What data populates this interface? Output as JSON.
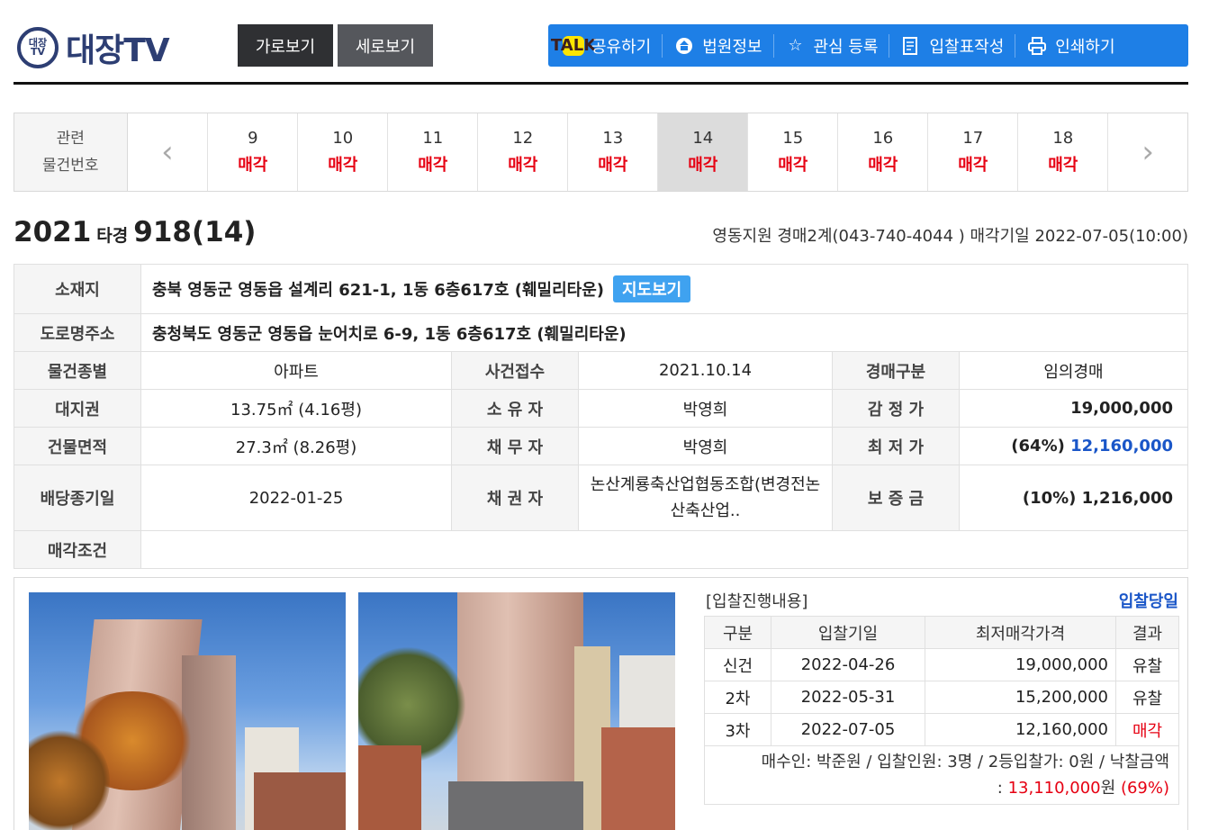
{
  "header": {
    "logo_mark": "대장TV",
    "logo_text": "대장TV",
    "view_horizontal": "가로보기",
    "view_vertical": "세로보기",
    "tools": [
      {
        "icon": "kakao-talk-icon",
        "icon_text": "TALK",
        "label": "공유하기"
      },
      {
        "icon": "court-icon",
        "icon_text": "",
        "label": "법원정보"
      },
      {
        "icon": "star-icon",
        "icon_text": "",
        "label": "관심 등록"
      },
      {
        "icon": "form-icon",
        "icon_text": "",
        "label": "입찰표작성"
      },
      {
        "icon": "printer-icon",
        "icon_text": "",
        "label": "인쇄하기"
      }
    ]
  },
  "related": {
    "label_line1": "관련",
    "label_line2": "물건번호",
    "items": [
      {
        "num": "9",
        "status": "매각"
      },
      {
        "num": "10",
        "status": "매각"
      },
      {
        "num": "11",
        "status": "매각"
      },
      {
        "num": "12",
        "status": "매각"
      },
      {
        "num": "13",
        "status": "매각"
      },
      {
        "num": "14",
        "status": "매각"
      },
      {
        "num": "15",
        "status": "매각"
      },
      {
        "num": "16",
        "status": "매각"
      },
      {
        "num": "17",
        "status": "매각"
      },
      {
        "num": "18",
        "status": "매각"
      }
    ],
    "active_index": 5
  },
  "case": {
    "year": "2021",
    "type": "타경",
    "number": "918(14)",
    "court_info": "영동지원 경매2계(043-740-4044 ) 매각기일 2022-07-05(10:00)"
  },
  "info": {
    "location_label": "소재지",
    "location": "충북 영동군 영동읍 설계리 621-1, 1동 6층617호 (훼밀리타운)",
    "map_button": "지도보기",
    "road_label": "도로명주소",
    "road": "충청북도 영동군 영동읍 눈어치로 6-9, 1동 6층617호 (훼밀리타운)",
    "rows": [
      [
        "물건종별",
        "아파트",
        "사건접수",
        "2021.10.14",
        "경매구분",
        "임의경매"
      ],
      [
        "대지권",
        "13.75㎡ (4.16평)",
        "소 유 자",
        "박영희",
        "감 정 가",
        "19,000,000"
      ],
      [
        "건물면적",
        "27.3㎡ (8.26평)",
        "채 무 자",
        "박영희",
        "최 저 가",
        "(64%) 12,160,000"
      ],
      [
        "배당종기일",
        "2022-01-25",
        "채 권 자",
        "논산계룡축산업협동조합(변경전논산축산업..",
        "보 증 금",
        "(10%) 1,216,000"
      ]
    ],
    "min_price_pct": "(64%)",
    "min_price": "12,160,000",
    "condition_label": "매각조건",
    "condition": ""
  },
  "bid": {
    "title": "[입찰진행내용]",
    "day_link": "입찰당일",
    "headers": [
      "구분",
      "입찰기일",
      "최저매각가격",
      "결과"
    ],
    "rows": [
      [
        "신건",
        "2022-04-26",
        "19,000,000",
        "유찰"
      ],
      [
        "2차",
        "2022-05-31",
        "15,200,000",
        "유찰"
      ],
      [
        "3차",
        "2022-07-05",
        "12,160,000",
        "매각"
      ]
    ],
    "buyer_line1": "매수인: 박준원 / 입찰인원: 3명 / 2등입찰가: 0원 / 낙찰금액",
    "buyer_prefix": ": ",
    "buyer_amount": "13,110,000",
    "buyer_unit": "원",
    "buyer_pct": "(69%)"
  },
  "colors": {
    "accent": "#1e7fe6",
    "sold": "#e60012",
    "link": "#1a56c8"
  }
}
